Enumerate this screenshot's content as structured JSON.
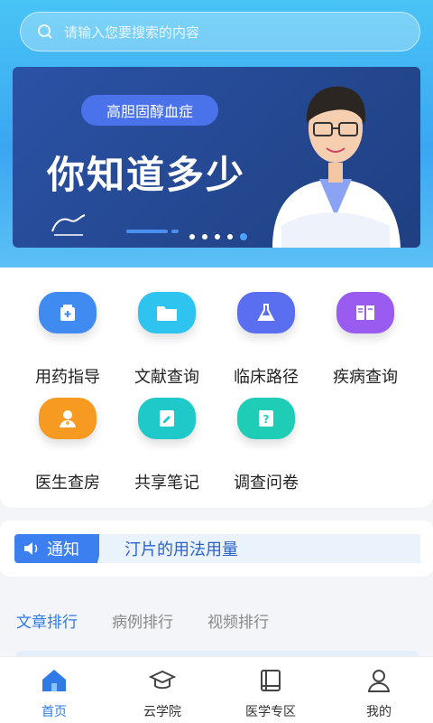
{
  "search": {
    "placeholder": "请输入您要搜索的内容"
  },
  "banner": {
    "tag": "高胆固醇血症",
    "headline": "你知道多少"
  },
  "grid": [
    {
      "label": "用药指导",
      "icon": "medicine-box-icon",
      "color": "#3f8bf1"
    },
    {
      "label": "文献查询",
      "icon": "folder-icon",
      "color": "#2fc4f0"
    },
    {
      "label": "临床路径",
      "icon": "flask-icon",
      "color": "#5a6ff0"
    },
    {
      "label": "疾病查询",
      "icon": "book-icon",
      "color": "#9a5bf0"
    },
    {
      "label": "医生查房",
      "icon": "doctor-icon",
      "color": "#f79a22"
    },
    {
      "label": "共享笔记",
      "icon": "note-icon",
      "color": "#20c9c9"
    },
    {
      "label": "调查问卷",
      "icon": "survey-icon",
      "color": "#1fcdb7"
    }
  ],
  "notice": {
    "tag": "通知",
    "text": "汀片的用法用量"
  },
  "tabs": [
    "文章排行",
    "病例排行",
    "视频排行"
  ],
  "nav": [
    {
      "label": "首页",
      "icon": "home-icon"
    },
    {
      "label": "云学院",
      "icon": "graduation-cap-icon"
    },
    {
      "label": "医学专区",
      "icon": "book-icon"
    },
    {
      "label": "我的",
      "icon": "user-icon"
    }
  ],
  "colors": {
    "accent": "#2f7ae5",
    "top_bg": "#3aa6f1"
  }
}
